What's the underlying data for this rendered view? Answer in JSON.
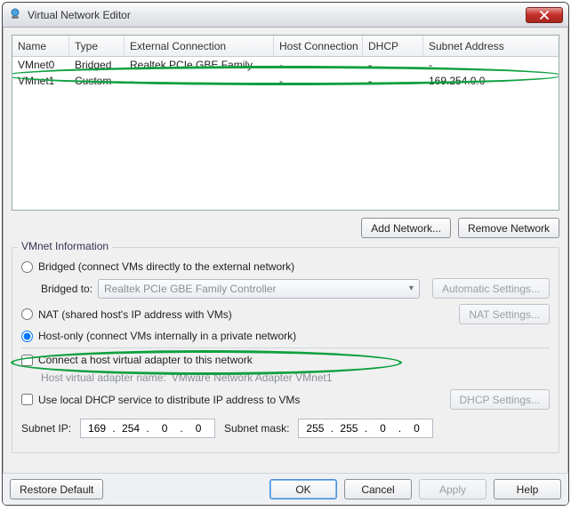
{
  "window": {
    "title": "Virtual Network Editor"
  },
  "table": {
    "headers": {
      "name": "Name",
      "type": "Type",
      "ext": "External Connection",
      "host": "Host Connection",
      "dhcp": "DHCP",
      "subnet": "Subnet Address"
    },
    "rows": [
      {
        "name": "VMnet0",
        "type": "Bridged",
        "ext": "Realtek PCIe GBE Family Co...",
        "host": "-",
        "dhcp": "-",
        "subnet": "-"
      },
      {
        "name": "VMnet1",
        "type": "Custom",
        "ext": "-",
        "host": "-",
        "dhcp": "-",
        "subnet": "169.254.0.0"
      }
    ]
  },
  "buttons": {
    "add_network": "Add Network...",
    "remove_network": "Remove Network",
    "automatic_settings": "Automatic Settings...",
    "nat_settings": "NAT Settings...",
    "dhcp_settings": "DHCP Settings...",
    "restore_default": "Restore Default",
    "ok": "OK",
    "cancel": "Cancel",
    "apply": "Apply",
    "help": "Help"
  },
  "info": {
    "legend": "VMnet Information",
    "bridged_label": "Bridged (connect VMs directly to the external network)",
    "bridged_to_label": "Bridged to:",
    "bridged_to_value": "Realtek PCIe GBE Family Controller",
    "nat_label": "NAT (shared host's IP address with VMs)",
    "hostonly_label": "Host-only (connect VMs internally in a private network)",
    "connect_host_adapter": "Connect a host virtual adapter to this network",
    "host_adapter_name_label": "Host virtual adapter name:",
    "host_adapter_name_value": "VMware Network Adapter VMnet1",
    "use_dhcp_label": "Use local DHCP service to distribute IP address to VMs",
    "subnet_ip_label": "Subnet IP:",
    "subnet_ip": [
      "169",
      "254",
      "0",
      "0"
    ],
    "subnet_mask_label": "Subnet mask:",
    "subnet_mask": [
      "255",
      "255",
      "0",
      "0"
    ]
  }
}
